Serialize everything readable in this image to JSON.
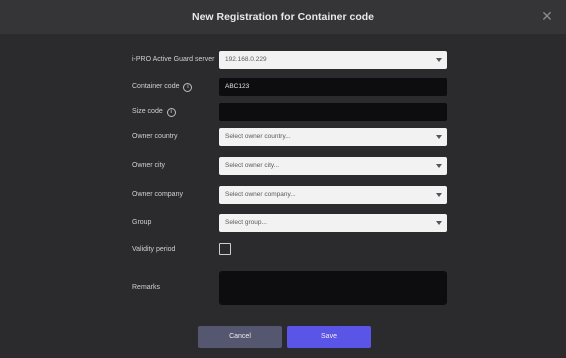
{
  "dialog": {
    "title": "New Registration for Container code",
    "close_icon": "close-icon"
  },
  "form": {
    "server": {
      "label": "i-PRO Active Guard server",
      "value": "192.168.0.229"
    },
    "container_code": {
      "label": "Container code",
      "info_icon": "info-icon",
      "value": "ABC123"
    },
    "size_code": {
      "label": "Size code",
      "info_icon": "info-icon",
      "value": ""
    },
    "owner_country": {
      "label": "Owner country",
      "placeholder": "Select owner country..."
    },
    "owner_city": {
      "label": "Owner city",
      "placeholder": "Select owner city..."
    },
    "owner_company": {
      "label": "Owner company",
      "placeholder": "Select owner company..."
    },
    "group": {
      "label": "Group",
      "placeholder": "Select group..."
    },
    "validity_period": {
      "label": "Validity period",
      "checked": false
    },
    "remarks": {
      "label": "Remarks",
      "value": ""
    }
  },
  "buttons": {
    "cancel": "Cancel",
    "save": "Save"
  },
  "colors": {
    "background": "#2b2b2e",
    "titlebar": "#353538",
    "cancel": "#55566f",
    "save": "#5a55e6"
  }
}
